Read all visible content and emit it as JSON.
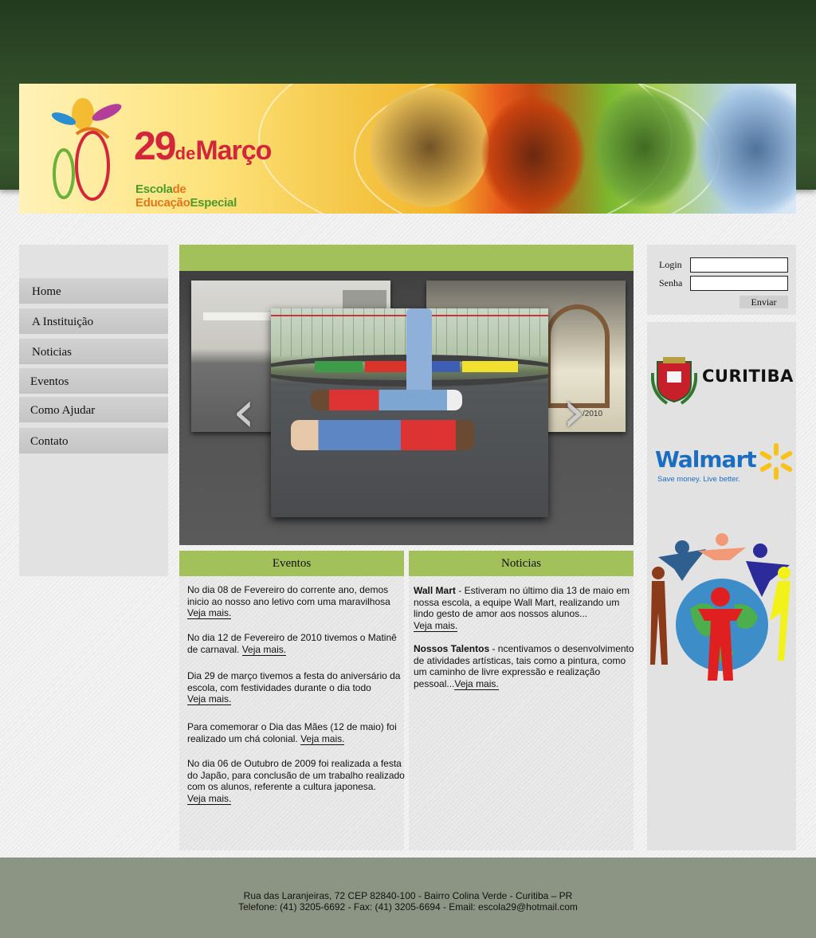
{
  "header": {
    "logo": {
      "number": "29",
      "de": "de",
      "marco": "Março",
      "subtitle_part1": "Escola",
      "subtitle_part2": "de Educação",
      "subtitle_part3": "Especial"
    }
  },
  "nav": {
    "items": [
      {
        "label": "Home"
      },
      {
        "label": "A Instituição"
      },
      {
        "label": "Noticias"
      },
      {
        "label": "Eventos"
      },
      {
        "label": "Como Ajudar"
      },
      {
        "label": "Contato"
      }
    ]
  },
  "slider": {
    "prev_icon": "chevron-left-icon",
    "next_icon": "chevron-right-icon",
    "thumb_caption": "/2010"
  },
  "eventos": {
    "title": "Eventos",
    "items": [
      {
        "text": "No dia 08 de Fevereiro do corrente ano, demos inicio ao nosso ano letivo com uma maravilhosa",
        "more": "Veja mais."
      },
      {
        "text": "No dia 12 de Fevereiro de 2010 tivemos o Matinê de carnaval.",
        "more": "Veja mais."
      },
      {
        "text": "Dia 29 de março tivemos a festa do aniversário da escola, com festividades durante o dia todo",
        "more": "Veja mais."
      },
      {
        "text": "Para comemorar o Dia das Mães (12 de maio) foi realizado um chá colonial.",
        "more": "Veja mais."
      },
      {
        "text": "No dia 06 de Outubro de 2009  foi realizada a festa do Japão, para conclusão de um trabalho realizado  com os alunos, referente a cultura japonesa.",
        "more": "Veja mais."
      }
    ]
  },
  "noticias": {
    "title": "Noticias",
    "items": [
      {
        "title": "Wall Mart",
        "text": " - Estiveram no último dia 13 de maio em nossa escola, a equipe Wall Mart, realizando um lindo gesto de amor aos nossos alunos...",
        "more": "Veja mais."
      },
      {
        "title": "Nossos Talentos",
        "text": " - ncentivamos o desenvolvimento de atividades artísticas, tais como a pintura, como um caminho de livre expressão e realização pessoal...",
        "more": "Veja mais."
      }
    ]
  },
  "login": {
    "login_label": "Login",
    "password_label": "Senha",
    "login_value": "",
    "password_value": "",
    "submit_label": "Enviar"
  },
  "sponsors": {
    "curitiba": "CURITIBA",
    "walmart": "Walmart",
    "walmart_tagline": "Save money. Live better."
  },
  "footer": {
    "address": "Rua das Laranjeiras, 72 CEP 82840-100 - Bairro Colina Verde - Curitiba – PR",
    "contact": "Telefone: (41) 3205-6692 - Fax: (41) 3205-6694 - Email: escola29@hotmail.com"
  },
  "colors": {
    "header_green": "#2e4a27",
    "accent_green": "#a3c15a",
    "footer": "#8c9583",
    "panel_gray": "#e2e2e2"
  }
}
